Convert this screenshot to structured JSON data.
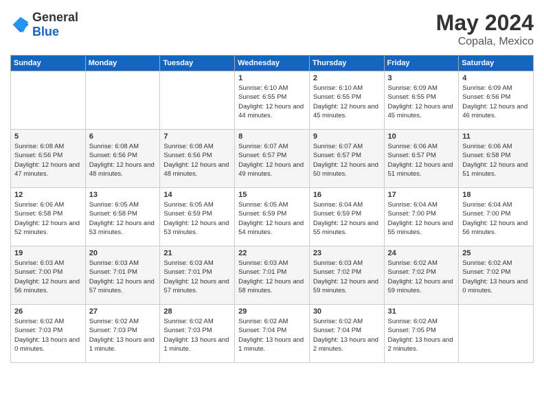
{
  "header": {
    "logo_general": "General",
    "logo_blue": "Blue",
    "month": "May 2024",
    "location": "Copala, Mexico"
  },
  "days_of_week": [
    "Sunday",
    "Monday",
    "Tuesday",
    "Wednesday",
    "Thursday",
    "Friday",
    "Saturday"
  ],
  "weeks": [
    [
      {
        "day": "",
        "info": ""
      },
      {
        "day": "",
        "info": ""
      },
      {
        "day": "",
        "info": ""
      },
      {
        "day": "1",
        "sunrise": "6:10 AM",
        "sunset": "6:55 PM",
        "daylight": "12 hours and 44 minutes."
      },
      {
        "day": "2",
        "sunrise": "6:10 AM",
        "sunset": "6:55 PM",
        "daylight": "12 hours and 45 minutes."
      },
      {
        "day": "3",
        "sunrise": "6:09 AM",
        "sunset": "6:55 PM",
        "daylight": "12 hours and 45 minutes."
      },
      {
        "day": "4",
        "sunrise": "6:09 AM",
        "sunset": "6:56 PM",
        "daylight": "12 hours and 46 minutes."
      }
    ],
    [
      {
        "day": "5",
        "sunrise": "6:08 AM",
        "sunset": "6:56 PM",
        "daylight": "12 hours and 47 minutes."
      },
      {
        "day": "6",
        "sunrise": "6:08 AM",
        "sunset": "6:56 PM",
        "daylight": "12 hours and 48 minutes."
      },
      {
        "day": "7",
        "sunrise": "6:08 AM",
        "sunset": "6:56 PM",
        "daylight": "12 hours and 48 minutes."
      },
      {
        "day": "8",
        "sunrise": "6:07 AM",
        "sunset": "6:57 PM",
        "daylight": "12 hours and 49 minutes."
      },
      {
        "day": "9",
        "sunrise": "6:07 AM",
        "sunset": "6:57 PM",
        "daylight": "12 hours and 50 minutes."
      },
      {
        "day": "10",
        "sunrise": "6:06 AM",
        "sunset": "6:57 PM",
        "daylight": "12 hours and 51 minutes."
      },
      {
        "day": "11",
        "sunrise": "6:06 AM",
        "sunset": "6:58 PM",
        "daylight": "12 hours and 51 minutes."
      }
    ],
    [
      {
        "day": "12",
        "sunrise": "6:06 AM",
        "sunset": "6:58 PM",
        "daylight": "12 hours and 52 minutes."
      },
      {
        "day": "13",
        "sunrise": "6:05 AM",
        "sunset": "6:58 PM",
        "daylight": "12 hours and 53 minutes."
      },
      {
        "day": "14",
        "sunrise": "6:05 AM",
        "sunset": "6:59 PM",
        "daylight": "12 hours and 53 minutes."
      },
      {
        "day": "15",
        "sunrise": "6:05 AM",
        "sunset": "6:59 PM",
        "daylight": "12 hours and 54 minutes."
      },
      {
        "day": "16",
        "sunrise": "6:04 AM",
        "sunset": "6:59 PM",
        "daylight": "12 hours and 55 minutes."
      },
      {
        "day": "17",
        "sunrise": "6:04 AM",
        "sunset": "7:00 PM",
        "daylight": "12 hours and 55 minutes."
      },
      {
        "day": "18",
        "sunrise": "6:04 AM",
        "sunset": "7:00 PM",
        "daylight": "12 hours and 56 minutes."
      }
    ],
    [
      {
        "day": "19",
        "sunrise": "6:03 AM",
        "sunset": "7:00 PM",
        "daylight": "12 hours and 56 minutes."
      },
      {
        "day": "20",
        "sunrise": "6:03 AM",
        "sunset": "7:01 PM",
        "daylight": "12 hours and 57 minutes."
      },
      {
        "day": "21",
        "sunrise": "6:03 AM",
        "sunset": "7:01 PM",
        "daylight": "12 hours and 57 minutes."
      },
      {
        "day": "22",
        "sunrise": "6:03 AM",
        "sunset": "7:01 PM",
        "daylight": "12 hours and 58 minutes."
      },
      {
        "day": "23",
        "sunrise": "6:03 AM",
        "sunset": "7:02 PM",
        "daylight": "12 hours and 59 minutes."
      },
      {
        "day": "24",
        "sunrise": "6:02 AM",
        "sunset": "7:02 PM",
        "daylight": "12 hours and 59 minutes."
      },
      {
        "day": "25",
        "sunrise": "6:02 AM",
        "sunset": "7:02 PM",
        "daylight": "13 hours and 0 minutes."
      }
    ],
    [
      {
        "day": "26",
        "sunrise": "6:02 AM",
        "sunset": "7:03 PM",
        "daylight": "13 hours and 0 minutes."
      },
      {
        "day": "27",
        "sunrise": "6:02 AM",
        "sunset": "7:03 PM",
        "daylight": "13 hours and 1 minute."
      },
      {
        "day": "28",
        "sunrise": "6:02 AM",
        "sunset": "7:03 PM",
        "daylight": "13 hours and 1 minute."
      },
      {
        "day": "29",
        "sunrise": "6:02 AM",
        "sunset": "7:04 PM",
        "daylight": "13 hours and 1 minute."
      },
      {
        "day": "30",
        "sunrise": "6:02 AM",
        "sunset": "7:04 PM",
        "daylight": "13 hours and 2 minutes."
      },
      {
        "day": "31",
        "sunrise": "6:02 AM",
        "sunset": "7:05 PM",
        "daylight": "13 hours and 2 minutes."
      },
      {
        "day": "",
        "info": ""
      }
    ]
  ]
}
